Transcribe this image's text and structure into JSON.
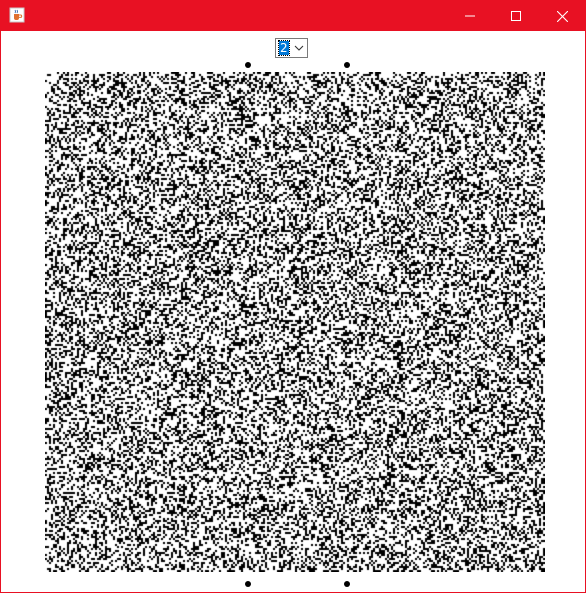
{
  "window": {
    "title": "",
    "app_icon": "java-cup-icon",
    "titlebar_color": "#e81123",
    "controls": [
      "minimize-icon",
      "maximize-icon",
      "close-icon"
    ]
  },
  "toolbar": {
    "combo_value": "2"
  },
  "canvas": {
    "description_type": "random-dot stereogram",
    "dot_color": "#000000",
    "background_color": "#ffffff"
  }
}
